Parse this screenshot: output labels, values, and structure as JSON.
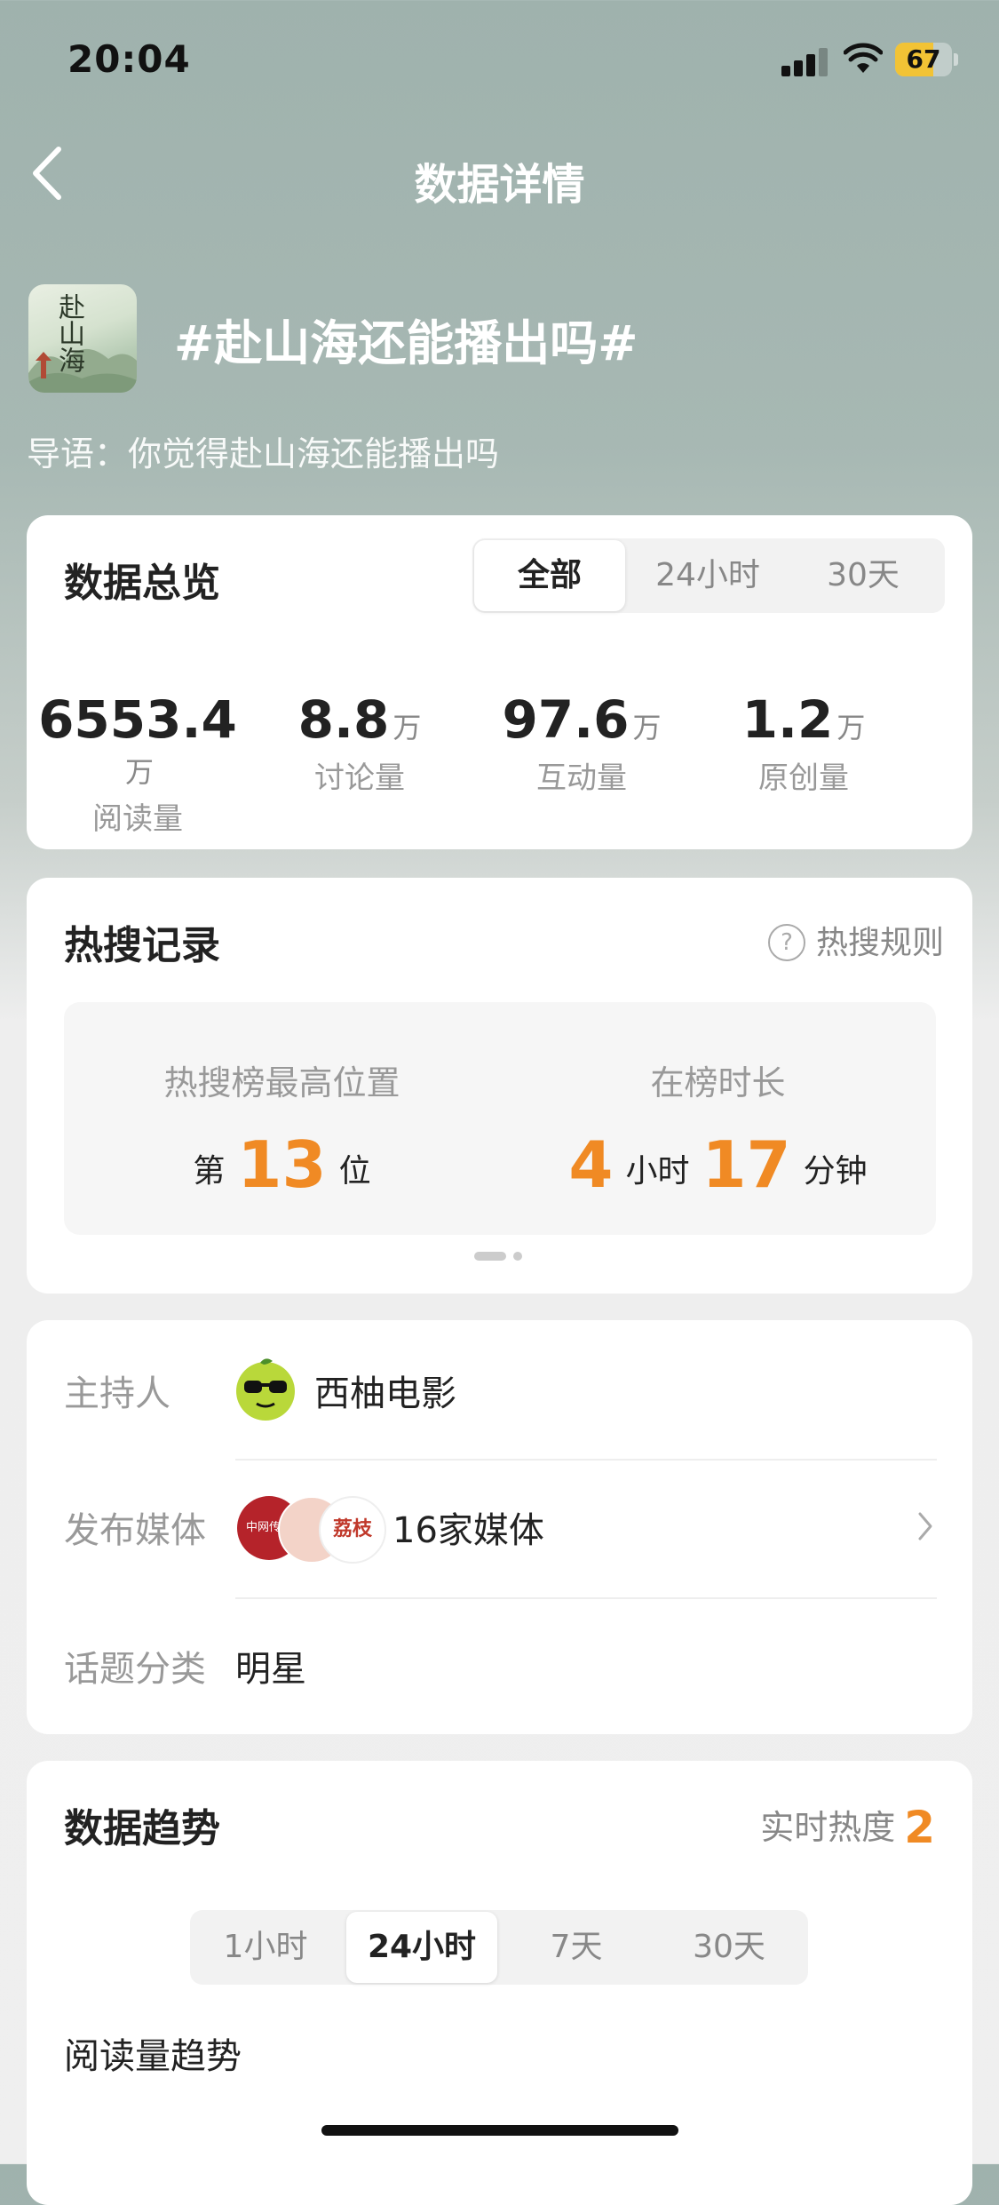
{
  "status_bar": {
    "time": "20:04",
    "battery": "67",
    "battery_level": 0.67
  },
  "nav": {
    "title": "数据详情"
  },
  "topic": {
    "title": "#赴山海还能播出吗#",
    "lead": "导语：你觉得赴山海还能播出吗",
    "cover_text": "赴山海"
  },
  "overview": {
    "title": "数据总览",
    "tabs": [
      "全部",
      "24小时",
      "30天"
    ],
    "active_tab": "全部",
    "stats": [
      {
        "value": "6553.4",
        "unit": "万",
        "label": "阅读量"
      },
      {
        "value": "8.8",
        "unit": "万",
        "label": "讨论量"
      },
      {
        "value": "97.6",
        "unit": "万",
        "label": "互动量"
      },
      {
        "value": "1.2",
        "unit": "万",
        "label": "原创量"
      }
    ]
  },
  "hot": {
    "title": "热搜记录",
    "rule_icon": "question-circle-icon",
    "rule_label": "热搜规则",
    "peak_label": "热搜榜最高位置",
    "peak_prefix": "第",
    "peak_value": "13",
    "peak_suffix": "位",
    "duration_label": "在榜时长",
    "hours": "4",
    "hours_unit": "小时",
    "minutes": "17",
    "minutes_unit": "分钟"
  },
  "info": {
    "host_label": "主持人",
    "host_name": "西柚电影",
    "media_label": "发布媒体",
    "media_count": "16家媒体",
    "media_logo1_text": "中网传播",
    "media_logo3_text": "荔枝",
    "category_label": "话题分类",
    "category_value": "明星"
  },
  "trend": {
    "title": "数据趋势",
    "realtime_label": "实时热度",
    "realtime_value": "2",
    "tabs": [
      "1小时",
      "24小时",
      "7天",
      "30天"
    ],
    "active_tab": "24小时",
    "section_label": "阅读量趋势"
  },
  "colors": {
    "accent": "#f08a24",
    "battery": "#f2c335"
  }
}
